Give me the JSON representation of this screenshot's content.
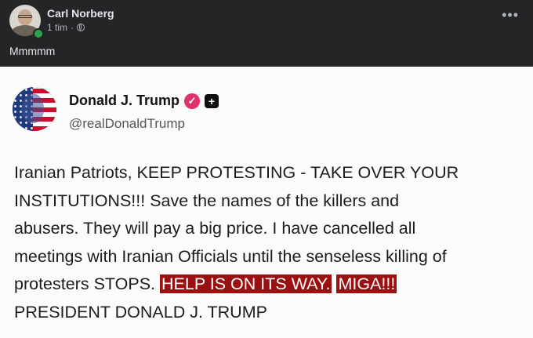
{
  "fb_post": {
    "author": "Carl Norberg",
    "time": "1 tim",
    "separator": "·",
    "caption": "Mmmmm",
    "more_glyph": "•••",
    "icons": {
      "privacy": "globe-icon",
      "more": "more-options-icon",
      "status": "online-status-dot"
    },
    "colors": {
      "background": "#242526",
      "text": "#e4e6eb",
      "online": "#31a24c"
    }
  },
  "truth_post": {
    "name": "Donald J. Trump",
    "handle": "@realDonaldTrump",
    "verified_glyph": "✓",
    "plus_glyph": "+",
    "body": {
      "line1": "Iranian Patriots, KEEP PROTESTING - TAKE OVER YOUR",
      "line2": "INSTITUTIONS!!! Save the names of the killers and",
      "line3": "abusers. They will pay a big price. I have cancelled all",
      "line4": "meetings with Iranian Officials until the senseless killing of",
      "line5_plain": "protesters STOPS.",
      "line5_highlight1": "HELP IS ON ITS WAY.",
      "line5_highlight2": "MIGA!!!",
      "line6": "PRESIDENT DONALD J. TRUMP"
    },
    "icons": {
      "verified": "verified-badge-icon",
      "plus": "plus-badge-icon"
    },
    "colors": {
      "highlight": "#9b1111",
      "verified": "#e0316f"
    }
  }
}
